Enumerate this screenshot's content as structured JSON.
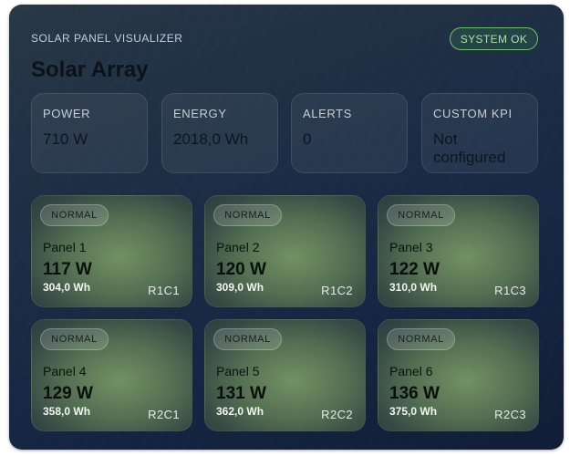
{
  "header": {
    "subtitle": "SOLAR PANEL VISUALIZER",
    "title": "Solar Array",
    "status": "SYSTEM OK"
  },
  "kpis": [
    {
      "label": "POWER",
      "value": "710 W"
    },
    {
      "label": "ENERGY",
      "value": "2018,0 Wh"
    },
    {
      "label": "ALERTS",
      "value": "0"
    },
    {
      "label": "CUSTOM KPI",
      "value": "Not configured"
    }
  ],
  "panels": [
    {
      "state": "NORMAL",
      "name": "Panel 1",
      "power": "117 W",
      "energy": "304,0 Wh",
      "position": "R1C1"
    },
    {
      "state": "NORMAL",
      "name": "Panel 2",
      "power": "120 W",
      "energy": "309,0 Wh",
      "position": "R1C2"
    },
    {
      "state": "NORMAL",
      "name": "Panel 3",
      "power": "122 W",
      "energy": "310,0 Wh",
      "position": "R1C3"
    },
    {
      "state": "NORMAL",
      "name": "Panel 4",
      "power": "129 W",
      "energy": "358,0 Wh",
      "position": "R2C1"
    },
    {
      "state": "NORMAL",
      "name": "Panel 5",
      "power": "131 W",
      "energy": "362,0 Wh",
      "position": "R2C2"
    },
    {
      "state": "NORMAL",
      "name": "Panel 6",
      "power": "136 W",
      "energy": "375,0 Wh",
      "position": "R2C3"
    }
  ],
  "colors": {
    "status_ok": "#6fbf73",
    "panel_glow": "#7a9866",
    "card_bg": "#1d2e45"
  }
}
